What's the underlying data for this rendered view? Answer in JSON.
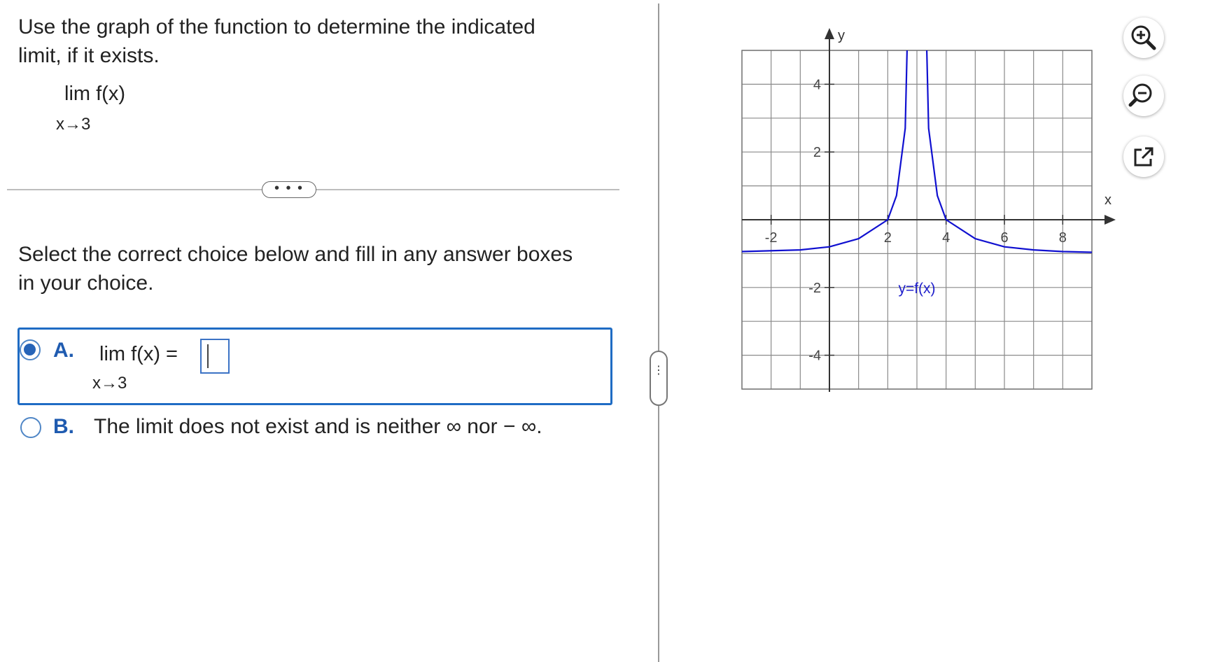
{
  "question": {
    "prompt": "Use the graph of the function to determine the indicated limit, if it exists.",
    "limit_expr": "lim  f(x)",
    "limit_sub": "x→3"
  },
  "more_button_label": "• • •",
  "instruction": "Select the correct choice below and fill in any answer boxes in your choice.",
  "choices": {
    "a": {
      "letter": "A.",
      "limit_expr": "lim  f(x) =",
      "limit_sub": "x→3",
      "selected": true,
      "answer_value": ""
    },
    "b": {
      "letter": "B.",
      "text": "The limit does not exist and is neither ∞ nor − ∞.",
      "selected": false
    }
  },
  "splitter_handle_label": "⋮",
  "tools": [
    "zoom-in-icon",
    "zoom-out-icon",
    "pop-out-icon"
  ],
  "colors": {
    "accent": "#1f6cc4",
    "curve": "#1010d0",
    "grid": "#888888"
  },
  "chart_data": {
    "type": "line",
    "xlabel": "x",
    "ylabel": "y",
    "xlim": [
      -3,
      9
    ],
    "ylim": [
      -5,
      5
    ],
    "grid": true,
    "x_ticks": [
      -2,
      2,
      4,
      6,
      8
    ],
    "y_ticks": [
      4,
      2,
      -2,
      -4
    ],
    "curve_label": "y=f(x)",
    "vertical_asymptote_x": 3,
    "horizontal_asymptote_y": -1,
    "series": [
      {
        "x": [
          -3,
          -1,
          0,
          1,
          2,
          2.3,
          2.6,
          2.8,
          2.9
        ],
        "y": [
          -0.94,
          -0.89,
          -0.8,
          -0.56,
          0.0,
          0.71,
          2.7,
          10.1,
          48.0
        ]
      },
      {
        "x": [
          3.1,
          3.2,
          3.4,
          3.7,
          4,
          5,
          6,
          7,
          8,
          9
        ],
        "y": [
          48.0,
          10.1,
          2.7,
          0.71,
          0.0,
          -0.56,
          -0.8,
          -0.89,
          -0.94,
          -0.96
        ]
      }
    ]
  }
}
